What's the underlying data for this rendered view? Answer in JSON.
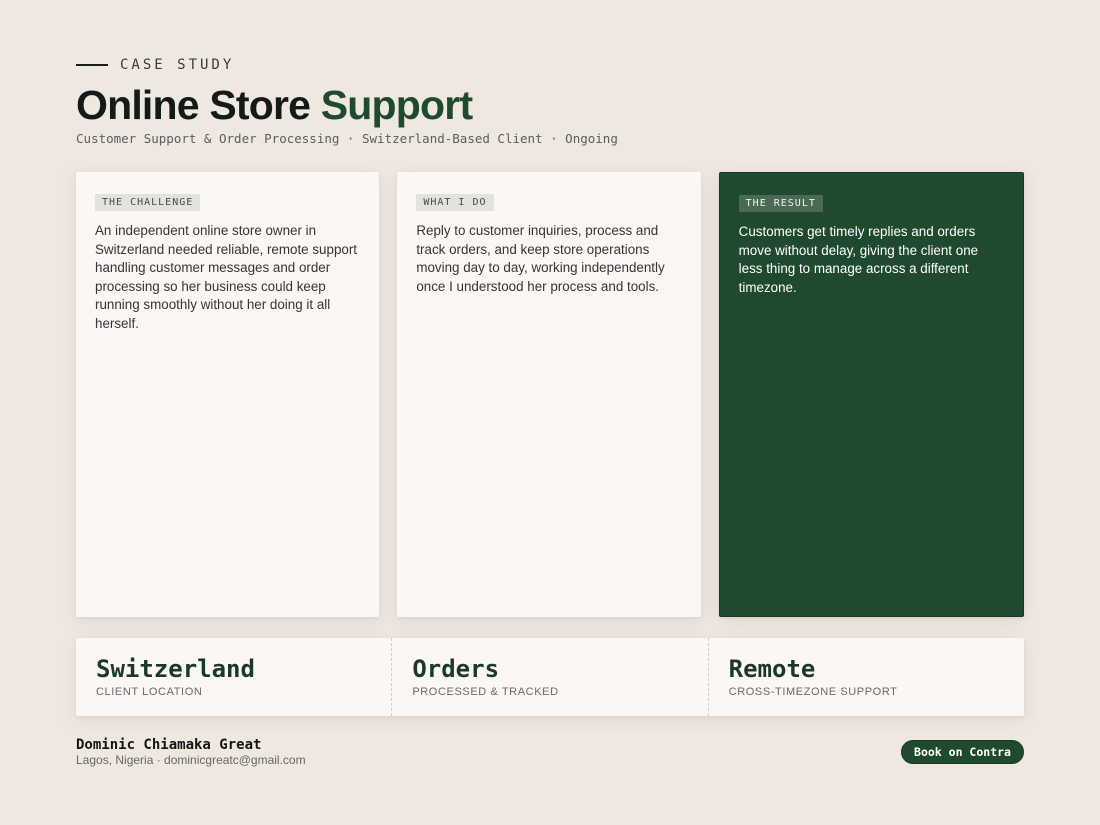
{
  "header": {
    "eyebrow": "CASE STUDY",
    "title_main": "Online Store",
    "title_accent": "Support",
    "subtitle": "Customer Support & Order Processing · Switzerland-Based Client · Ongoing"
  },
  "cards": [
    {
      "tag": "THE CHALLENGE",
      "body": "An independent online store owner in Switzerland needed reliable, remote support handling customer messages and order processing so her business could keep running smoothly without her doing it all herself."
    },
    {
      "tag": "WHAT I DO",
      "body": "Reply to customer inquiries, process and track orders, and keep store operations moving day to day, working independently once I understood her process and tools."
    },
    {
      "tag": "THE RESULT",
      "body": "Customers get timely replies and orders move without delay, giving the client one less thing to manage across a different timezone."
    }
  ],
  "stats": [
    {
      "value": "Switzerland",
      "label": "CLIENT LOCATION"
    },
    {
      "value": "Orders",
      "label": "PROCESSED & TRACKED"
    },
    {
      "value": "Remote",
      "label": "CROSS-TIMEZONE SUPPORT"
    }
  ],
  "footer": {
    "name": "Dominic Chiamaka Great",
    "meta": "Lagos, Nigeria · dominicgreatc@gmail.com",
    "cta_label": "Book on Contra"
  },
  "colors": {
    "background": "#efe8e1",
    "accent_green": "#1f4a2e",
    "card_background": "#faf7f5"
  }
}
